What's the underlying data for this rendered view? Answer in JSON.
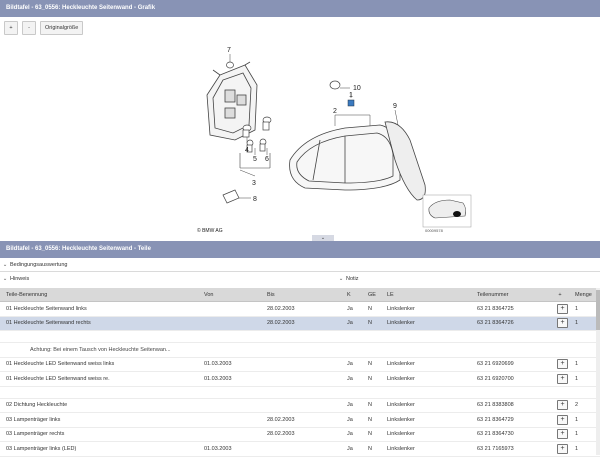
{
  "graphic_panel": {
    "title": "Bildtafel - 63_0556: Heckleuchte Seitenwand - Grafik",
    "zoom_in_label": "+",
    "zoom_out_label": "-",
    "original_size_label": "Originalgröße",
    "callouts": [
      "7",
      "10",
      "1",
      "9",
      "2",
      "4",
      "5",
      "6",
      "3",
      "8"
    ],
    "copyright": "© BMW AG",
    "image_code": "00009578"
  },
  "parts_panel": {
    "title": "Bildtafel - 63_0556: Heckleuchte Seitenwand - Teile",
    "collapse_icon": "chevron-down",
    "sections": {
      "conditions": "Bedingungsauswertung",
      "hints": "Hinweis",
      "notes": "Notiz"
    },
    "columns": [
      "Teile-Benennung",
      "Von",
      "Bis",
      "K",
      "GE",
      "LE",
      "Teilenummer",
      "+",
      "Menge"
    ],
    "rows": [
      {
        "name": "01 Heckleuchte Seitenwand links",
        "von": "",
        "bis": "28.02.2003",
        "k": "Ja",
        "ge": "N",
        "le": "Linkslenker",
        "nr": "63 21 8364725",
        "add": "+",
        "qty": "1",
        "selected": false
      },
      {
        "name": "01 Heckleuchte Seitenwand rechts",
        "von": "",
        "bis": "28.02.2003",
        "k": "Ja",
        "ge": "N",
        "le": "Linkslenker",
        "nr": "63 21 8364726",
        "add": "+",
        "qty": "1",
        "selected": true
      },
      {
        "name": "",
        "von": "",
        "bis": "",
        "k": "",
        "ge": "",
        "le": "",
        "nr": "",
        "add": "",
        "qty": "",
        "blank": true
      },
      {
        "name": "Achtung: Bei einem Tausch von Heckleuchte Seitenwan...",
        "von": "",
        "bis": "",
        "k": "",
        "ge": "",
        "le": "",
        "nr": "",
        "add": "",
        "qty": "",
        "note": true
      },
      {
        "name": "01 Heckleuchte LED Seitenwand weiss links",
        "von": "01.03.2003",
        "bis": "",
        "k": "Ja",
        "ge": "N",
        "le": "Linkslenker",
        "nr": "63 21 6920699",
        "add": "+",
        "qty": "1"
      },
      {
        "name": "01 Heckleuchte LED Seitenwand weiss re.",
        "von": "01.03.2003",
        "bis": "",
        "k": "Ja",
        "ge": "N",
        "le": "Linkslenker",
        "nr": "63 21 6920700",
        "add": "+",
        "qty": "1"
      },
      {
        "name": "",
        "von": "",
        "bis": "",
        "k": "",
        "ge": "",
        "le": "",
        "nr": "",
        "add": "",
        "qty": "",
        "blank": true
      },
      {
        "name": "02 Dichtung Heckleuchte",
        "von": "",
        "bis": "",
        "k": "Ja",
        "ge": "N",
        "le": "Linkslenker",
        "nr": "63 21 8383808",
        "add": "+",
        "qty": "2"
      },
      {
        "name": "03 Lampenträger links",
        "von": "",
        "bis": "28.02.2003",
        "k": "Ja",
        "ge": "N",
        "le": "Linkslenker",
        "nr": "63 21 8364729",
        "add": "+",
        "qty": "1"
      },
      {
        "name": "03 Lampenträger rechts",
        "von": "",
        "bis": "28.02.2003",
        "k": "Ja",
        "ge": "N",
        "le": "Linkslenker",
        "nr": "63 21 8364730",
        "add": "+",
        "qty": "1"
      },
      {
        "name": "03 Lampenträger links (LED)",
        "von": "01.03.2003",
        "bis": "",
        "k": "Ja",
        "ge": "N",
        "le": "Linkslenker",
        "nr": "63 21 7165973",
        "add": "+",
        "qty": "1"
      }
    ]
  }
}
